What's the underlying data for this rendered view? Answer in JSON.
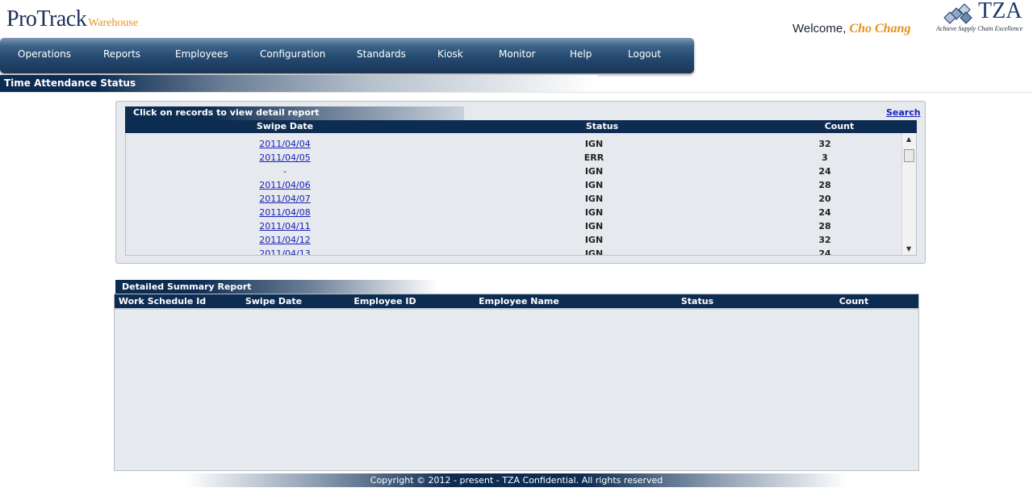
{
  "brand": {
    "name": "ProTrack",
    "sub": "Warehouse"
  },
  "welcome": {
    "prefix": "Welcome,",
    "user": "Cho Chang"
  },
  "company": {
    "name": "TZA",
    "tagline": "Achieve Supply Chain Excellence"
  },
  "nav": [
    "Operations",
    "Reports",
    "Employees",
    "Configuration",
    "Standards",
    "Kiosk",
    "Monitor",
    "Help",
    "Logout"
  ],
  "page_title": "Time Attendance Status",
  "records": {
    "title": "Click on records to view detail report",
    "search_label": "Search",
    "columns": [
      "Swipe Date",
      "Status",
      "Count"
    ],
    "rows": [
      {
        "date": "2011/04/04",
        "status": "IGN",
        "count": "32",
        "link": true
      },
      {
        "date": "2011/04/05",
        "status": "ERR",
        "count": "3",
        "link": true
      },
      {
        "date": "-",
        "status": "IGN",
        "count": "24",
        "link": false
      },
      {
        "date": "2011/04/06",
        "status": "IGN",
        "count": "28",
        "link": true
      },
      {
        "date": "2011/04/07",
        "status": "IGN",
        "count": "20",
        "link": true
      },
      {
        "date": "2011/04/08",
        "status": "IGN",
        "count": "24",
        "link": true
      },
      {
        "date": "2011/04/11",
        "status": "IGN",
        "count": "28",
        "link": true
      },
      {
        "date": "2011/04/12",
        "status": "IGN",
        "count": "32",
        "link": true
      },
      {
        "date": "2011/04/13",
        "status": "IGN",
        "count": "24",
        "link": true
      }
    ]
  },
  "summary": {
    "title": "Detailed Summary Report",
    "columns": [
      "Work Schedule Id",
      "Swipe Date",
      "Employee ID",
      "Employee Name",
      "Status",
      "Count"
    ]
  },
  "footer": "Copyright © 2012 - present - TZA Confidential. All rights reserved"
}
